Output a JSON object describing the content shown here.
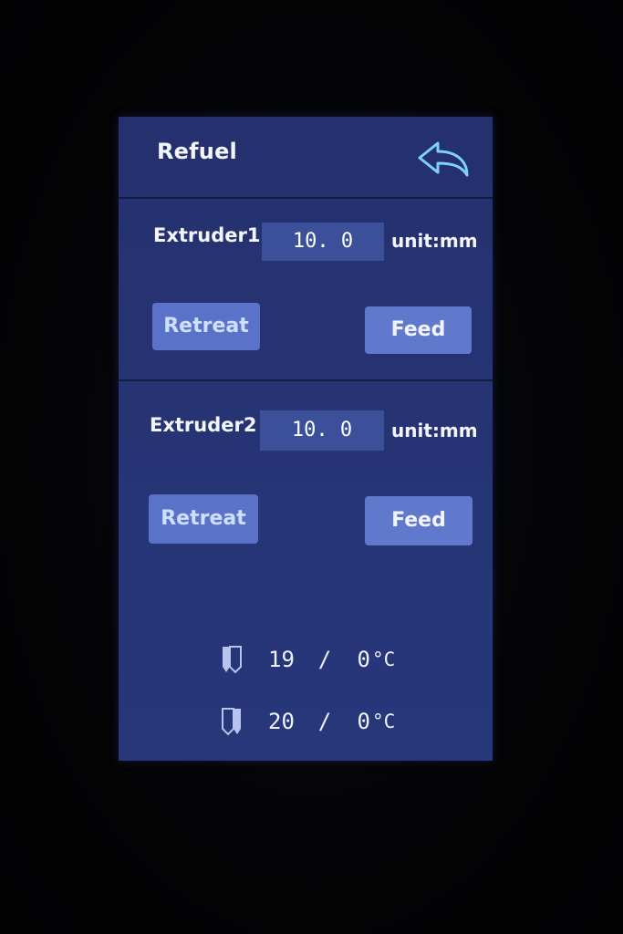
{
  "header": {
    "title": "Refuel",
    "back_icon": "back-arrow-icon"
  },
  "extruders": [
    {
      "label": "Extruder1",
      "value": "10. 0",
      "unit": "unit:mm",
      "retreat_label": "Retreat",
      "feed_label": "Feed"
    },
    {
      "label": "Extruder2",
      "value": "10. 0",
      "unit": "unit:mm",
      "retreat_label": "Retreat",
      "feed_label": "Feed"
    }
  ],
  "status": {
    "temps": [
      {
        "icon": "nozzle-left-icon",
        "current": "19",
        "separator": "/",
        "target": "0",
        "unit": "°C"
      },
      {
        "icon": "nozzle-right-icon",
        "current": "20",
        "separator": "/",
        "target": "0",
        "unit": "°C"
      }
    ]
  },
  "colors": {
    "screen_bg": "#263474",
    "field_bg": "#3b4f9a",
    "button_bg": "#5a73c8",
    "retreat_text": "#cfe0ff",
    "icon_stroke": "#7fd0ff"
  }
}
